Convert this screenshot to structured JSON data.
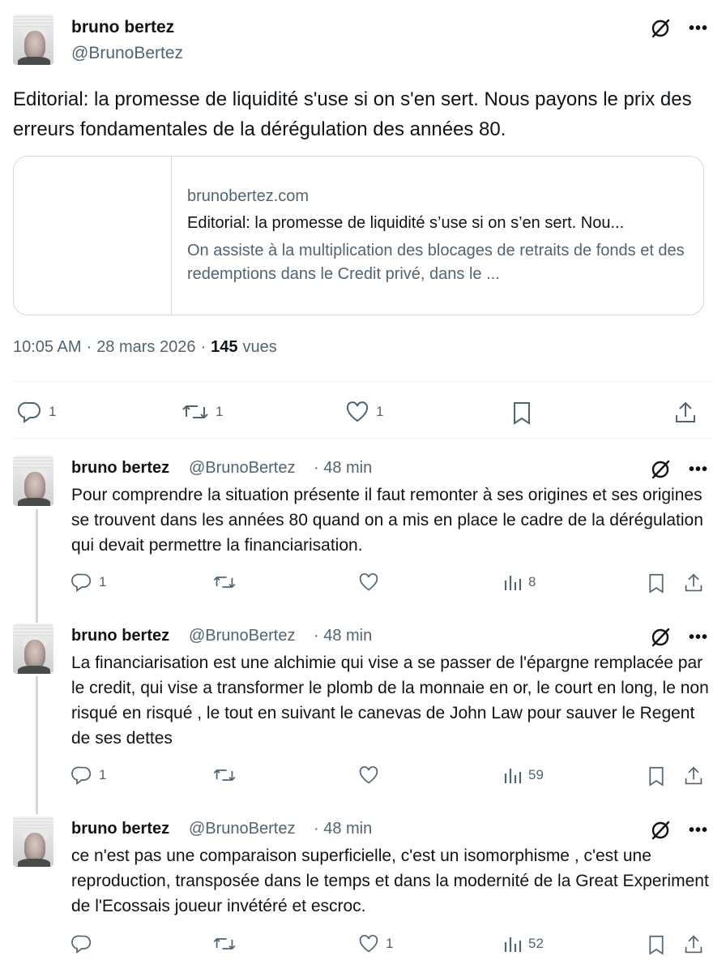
{
  "main": {
    "name": "bruno bertez",
    "handle": "@BrunoBertez",
    "text": "Editorial: la promesse de liquidité s'use si on s'en sert. Nous payons le prix des erreurs fondamentales de la dérégulation des années 80.",
    "card": {
      "domain": "brunobertez.com",
      "title": "Editorial: la promesse de liquidité s’use si on s’en sert. Nou...",
      "description": "On assiste à la multiplication des blocages de retraits de fonds et des redemptions dans le Credit privé, dans le ..."
    },
    "time": "10:05 AM",
    "date": "28 mars 2026",
    "views_count": "145",
    "views_label": "vues",
    "reply_count": "1",
    "retweet_count": "1",
    "like_count": "1"
  },
  "replies": [
    {
      "name": "bruno bertez",
      "handle": "@BrunoBertez",
      "time": "· 48 min",
      "text": "Pour comprendre la situation présente il faut remonter à ses origines et ses origines se trouvent dans les années 80 quand  on a mis en place le cadre de la dérégulation qui devait permettre la financiarisation.",
      "reply_count": "1",
      "retweet_count": "",
      "like_count": "",
      "views": "8"
    },
    {
      "name": "bruno bertez",
      "handle": "@BrunoBertez",
      "time": "· 48 min",
      "text": "La financiarisation est une alchimie qui vise a se passer de l'épargne remplacée par le credit,  qui vise a transformer le plomb de la monnaie en or, le court en long, le non risqué en risqué , le tout en suivant le canevas  de John Law  pour sauver le Regent de ses dettes",
      "reply_count": "1",
      "retweet_count": "",
      "like_count": "",
      "views": "59"
    },
    {
      "name": "bruno bertez",
      "handle": "@BrunoBertez",
      "time": "· 48 min",
      "text": "ce n'est pas une comparaison superficielle, c'est un isomorphisme , c'est une reproduction, transposée dans le temps et dans la modernité de la Great Experiment de l'Ecossais joueur invétéré et escroc.",
      "reply_count": "",
      "retweet_count": "",
      "like_count": "1",
      "views": "52"
    }
  ],
  "icons": {
    "grok": "grok-icon",
    "more": "more-icon",
    "reply": "reply-icon",
    "retweet": "retweet-icon",
    "like": "heart-icon",
    "bookmark": "bookmark-icon",
    "share": "share-icon",
    "views": "views-icon"
  },
  "colors": {
    "text": "#0f1419",
    "secondary": "#536471",
    "border": "#cfd9de"
  }
}
